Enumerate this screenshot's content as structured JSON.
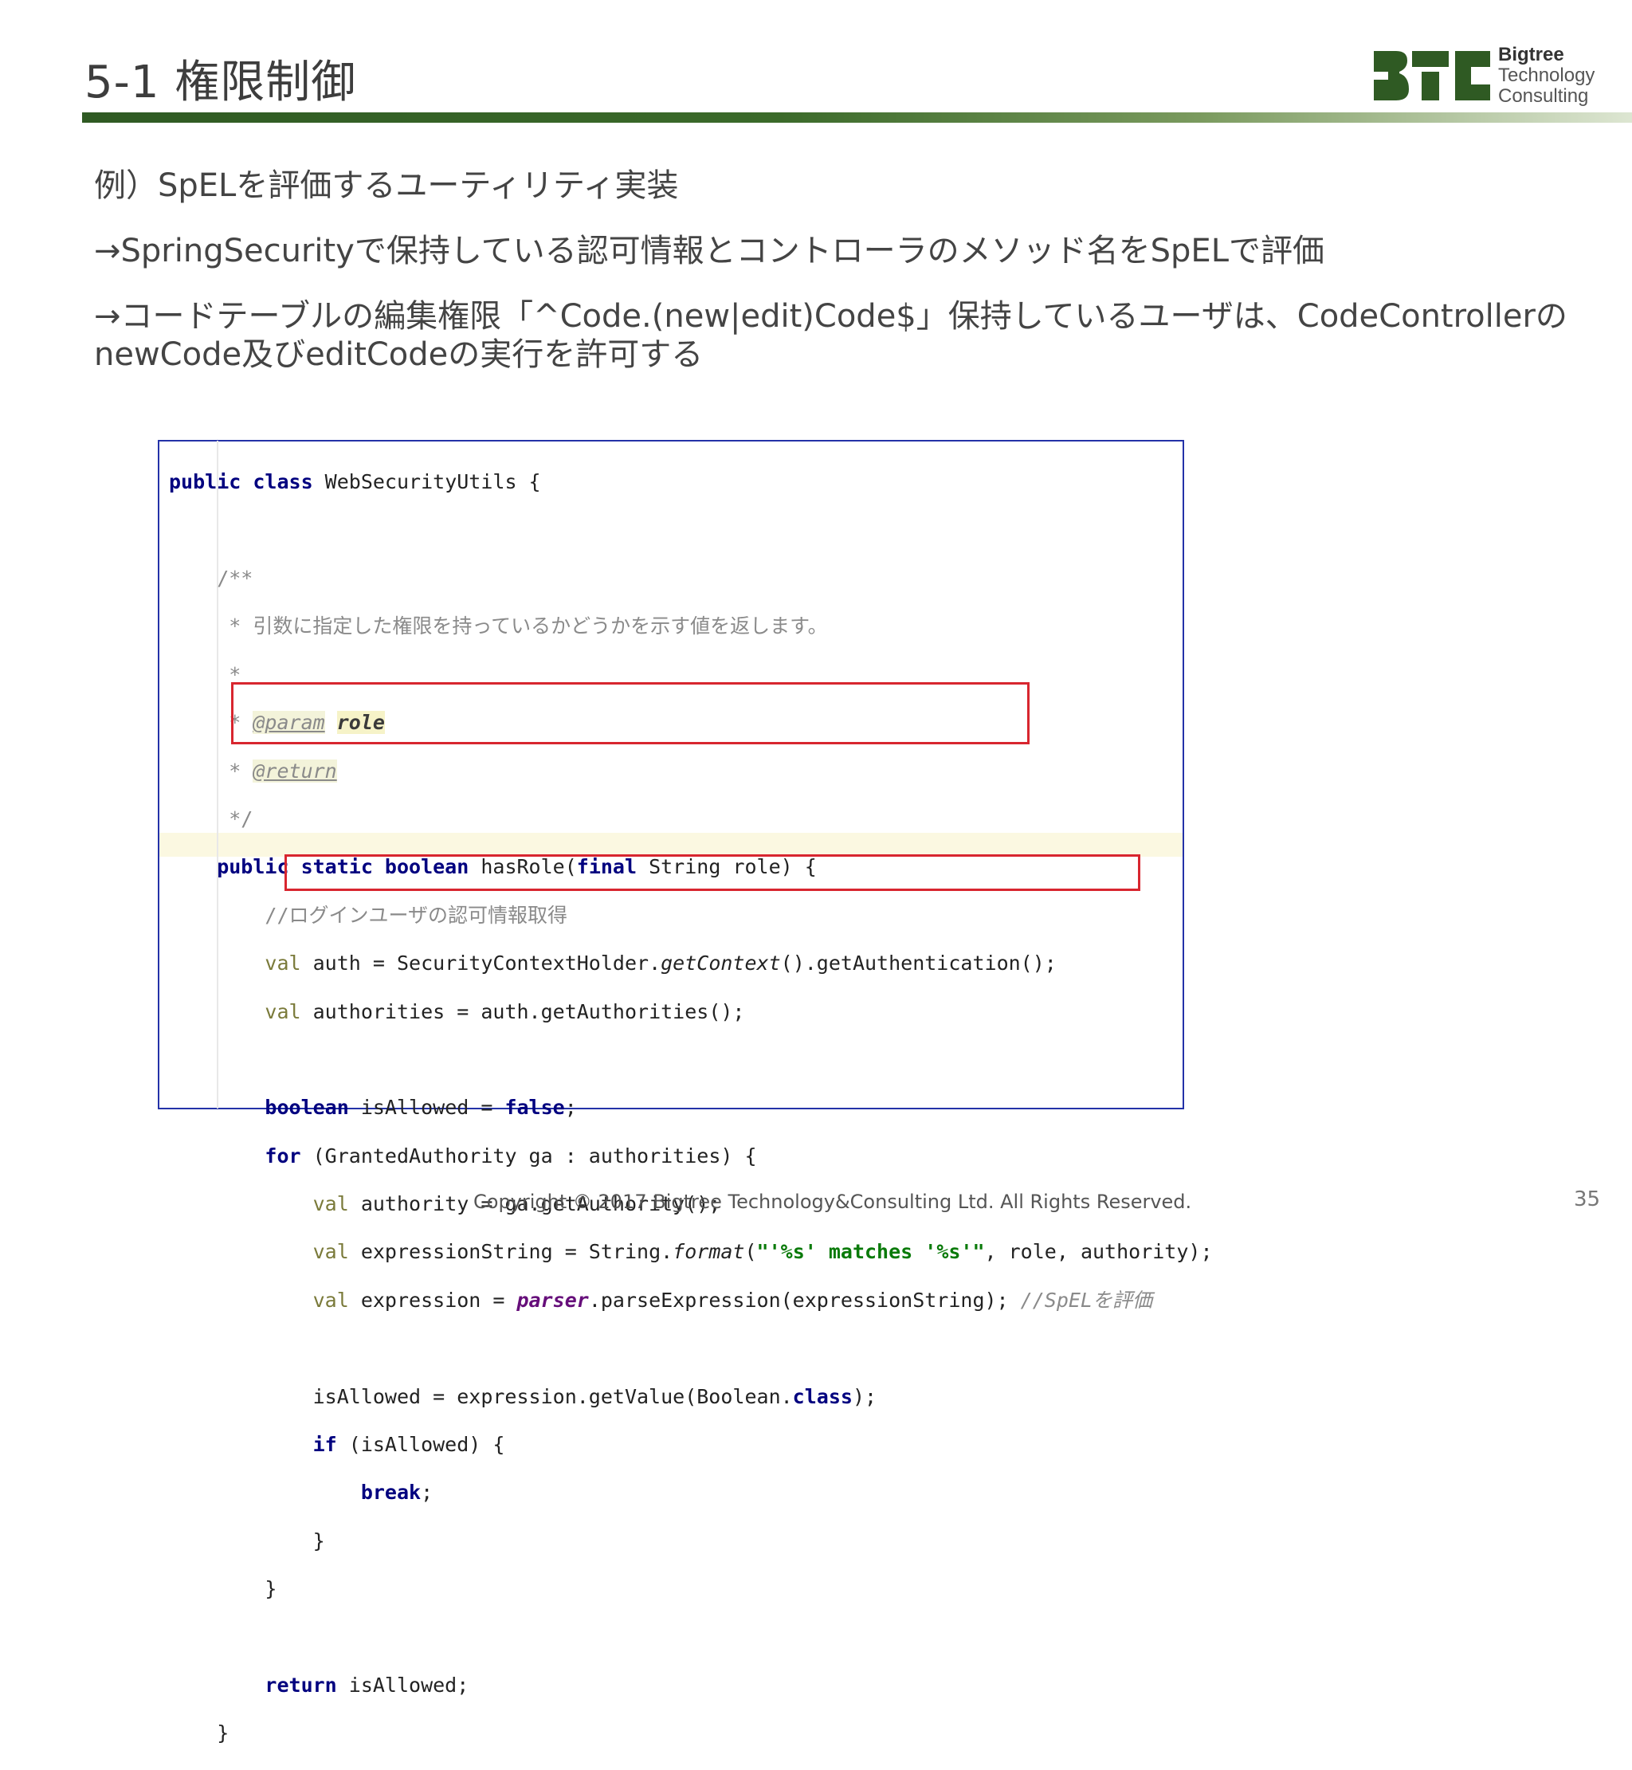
{
  "slide": {
    "title": "5-1 権限制御",
    "paragraphs": [
      "例）SpELを評価するユーティリティ実装",
      "→SpringSecurityで保持している認可情報とコントローラのメソッド名をSpELで評価",
      "→コードテーブルの編集権限「^Code.(new|edit)Code$」保持しているユーザは、CodeControllerの",
      "newCode及びeditCodeの実行を許可する"
    ],
    "footer": "Copyright © 2017 Bigtree Technology&Consulting Ltd. All Rights Reserved.",
    "page_number": "35"
  },
  "logo": {
    "line1": "Bigtree",
    "line2": "Technology",
    "line3": "Consulting",
    "colors": {
      "dark_green": "#2f5a23",
      "gray": "#555555"
    }
  },
  "code": {
    "l1a": "public class",
    "l1b": " WebSecurityUtils {",
    "l3": "    /**",
    "l4": "     * 引数に指定した権限を持っているかどうかを示す値を返します。",
    "l5": "     *",
    "l6a": "     * ",
    "l6tag": "@param",
    "l6sp": " ",
    "l6param": "role",
    "l7a": "     * ",
    "l7tag": "@return",
    "l8": "     */",
    "l9a": "    public static boolean",
    "l9b": " hasRole(",
    "l9c": "final",
    "l9d": " String role) {",
    "l10": "        //ログインユーザの認可情報取得",
    "l11a": "        val",
    "l11b": " auth = SecurityContextHolder.",
    "l11c": "getContext",
    "l11d": "().getAuthentication();",
    "l12a": "        val",
    "l12b": " authorities = auth.getAuthorities();",
    "l14a": "        boolean",
    "l14b": " isAllowed = ",
    "l14c": "false",
    "l14d": ";",
    "l15a": "        for",
    "l15b": " (GrantedAuthority ga : authorities) {",
    "l16a": "            val",
    "l16b": " authority = ga.getAuthority();",
    "l17a": "            val",
    "l17b": " expressionString = String.",
    "l17c": "format",
    "l17d": "(",
    "l17e": "\"'%s' matches '%s'\"",
    "l17f": ", role, authority);",
    "l18a": "            val",
    "l18b": " expression = ",
    "l18c": "parser",
    "l18d": ".parseExpression(expressionString); ",
    "l18e": "//SpELを評価",
    "l20a": "            isAllowed = expression.getValue(Boolean.",
    "l20b": "class",
    "l20c": ");",
    "l21a": "            if",
    "l21b": " (isAllowed) {",
    "l22a": "                break",
    "l22b": ";",
    "l23": "            }",
    "l24": "        }",
    "l26a": "        return",
    "l26b": " isAllowed;",
    "l27": "    }"
  },
  "colors": {
    "keyword": "#00007f",
    "comment": "#8a8a8a",
    "string": "#0a7a0a",
    "highlight_box": "#d8262f",
    "frame": "#2432a8"
  }
}
